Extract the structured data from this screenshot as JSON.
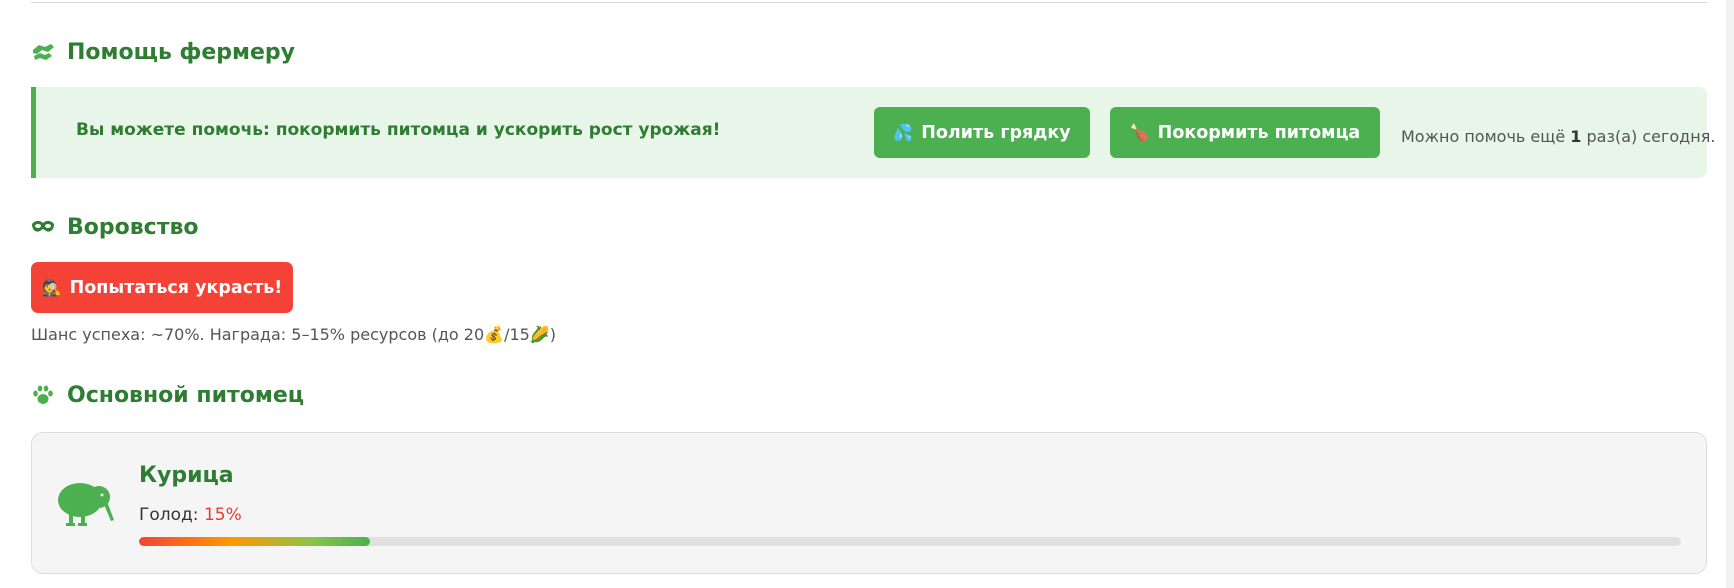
{
  "help_section": {
    "title": "Помощь фермеру",
    "icon": "helping-hand-icon",
    "message": "Вы можете помочь: покормить питомца и ускорить рост урожая!",
    "water_button": {
      "emoji": "💦",
      "label": "Полить грядку"
    },
    "feed_button": {
      "emoji": "🍗",
      "label": "Покормить питомца"
    },
    "limit_prefix": "Можно помочь ещё ",
    "limit_count": "1",
    "limit_suffix": " раз(а) сегодня."
  },
  "theft_section": {
    "title": "Воровство",
    "icon": "mask-icon",
    "steal_button": {
      "emoji": "🕵️",
      "label": "Попытаться украсть!"
    },
    "info_prefix": "Шанс успеха: ~70%. Награда: 5–15% ресурсов (до 20",
    "info_coin_emoji": "💰",
    "info_middle": "/15",
    "info_corn_emoji": "🌽",
    "info_suffix": ")"
  },
  "pet_section": {
    "title": "Основной питомец",
    "icon": "paw-icon",
    "pet": {
      "icon": "kiwi-bird-icon",
      "name": "Курица",
      "hunger_label": "Голод:",
      "hunger_value": "15%",
      "hunger_fraction": 0.15
    }
  },
  "colors": {
    "primary_green": "#4caf50",
    "title_green": "#2e7d32",
    "panel_bg": "#e8f5e9",
    "danger_red": "#f44336"
  }
}
